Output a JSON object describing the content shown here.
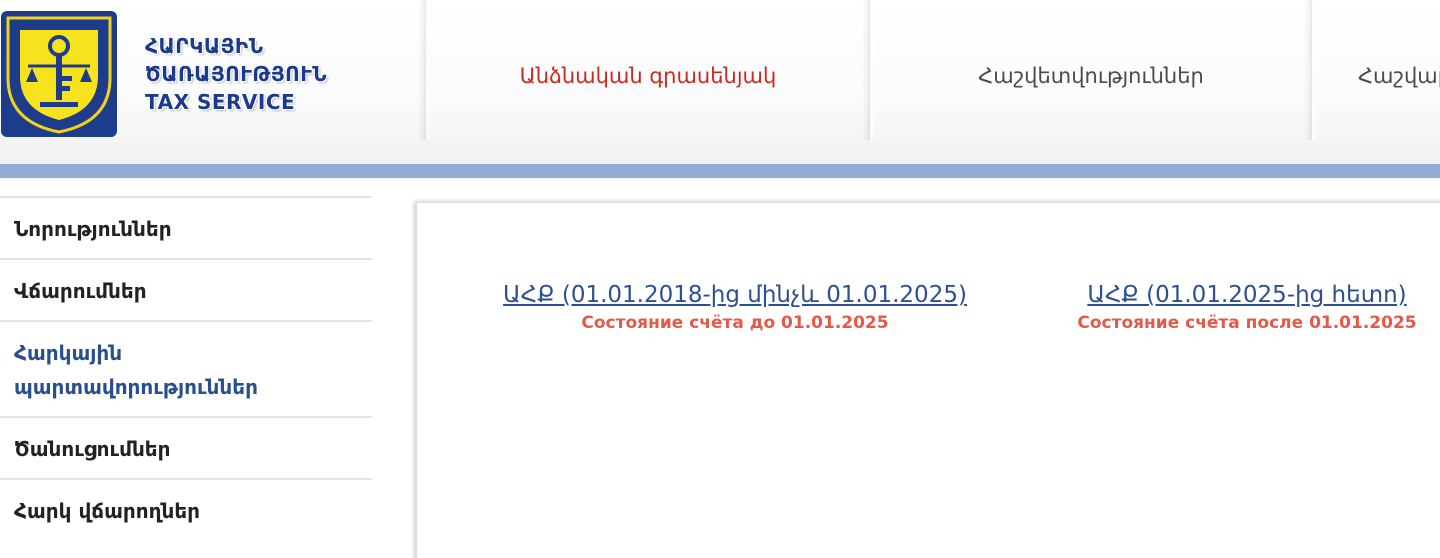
{
  "logo": {
    "line1": "ՀԱՐԿԱՅԻՆ",
    "line2": "ԾԱՌԱՅՈՒԹՅՈՒՆ",
    "line3": "TAX SERVICE"
  },
  "nav": {
    "items": [
      {
        "label": "Անձնական գրասենյակ"
      },
      {
        "label": "Հաշվետվություններ"
      },
      {
        "label": "Հաշվար"
      }
    ]
  },
  "sidebar": {
    "items": [
      {
        "label": "Նորություններ"
      },
      {
        "label": "Վճարումներ"
      },
      {
        "label_line1": "Հարկային",
        "label_line2": "պարտավորություններ"
      },
      {
        "label": "Ծանուցումներ"
      },
      {
        "label": "Հարկ վճարողներ"
      }
    ]
  },
  "content": {
    "vat_before": {
      "link": "ԱՀՔ (01.01.2018-ից մինչև 01.01.2025)",
      "subtitle": "Состояние счёта до 01.01.2025"
    },
    "vat_after": {
      "link": "ԱՀՔ (01.01.2025-ից հետո)",
      "subtitle": "Состояние счёта после 01.01.2025"
    }
  },
  "colors": {
    "brand_blue": "#1c3a8a",
    "active_red": "#cc2a1f",
    "bar_blue": "#93acd7",
    "link_blue": "#2d4f93",
    "subtitle_red": "#e35a49"
  }
}
